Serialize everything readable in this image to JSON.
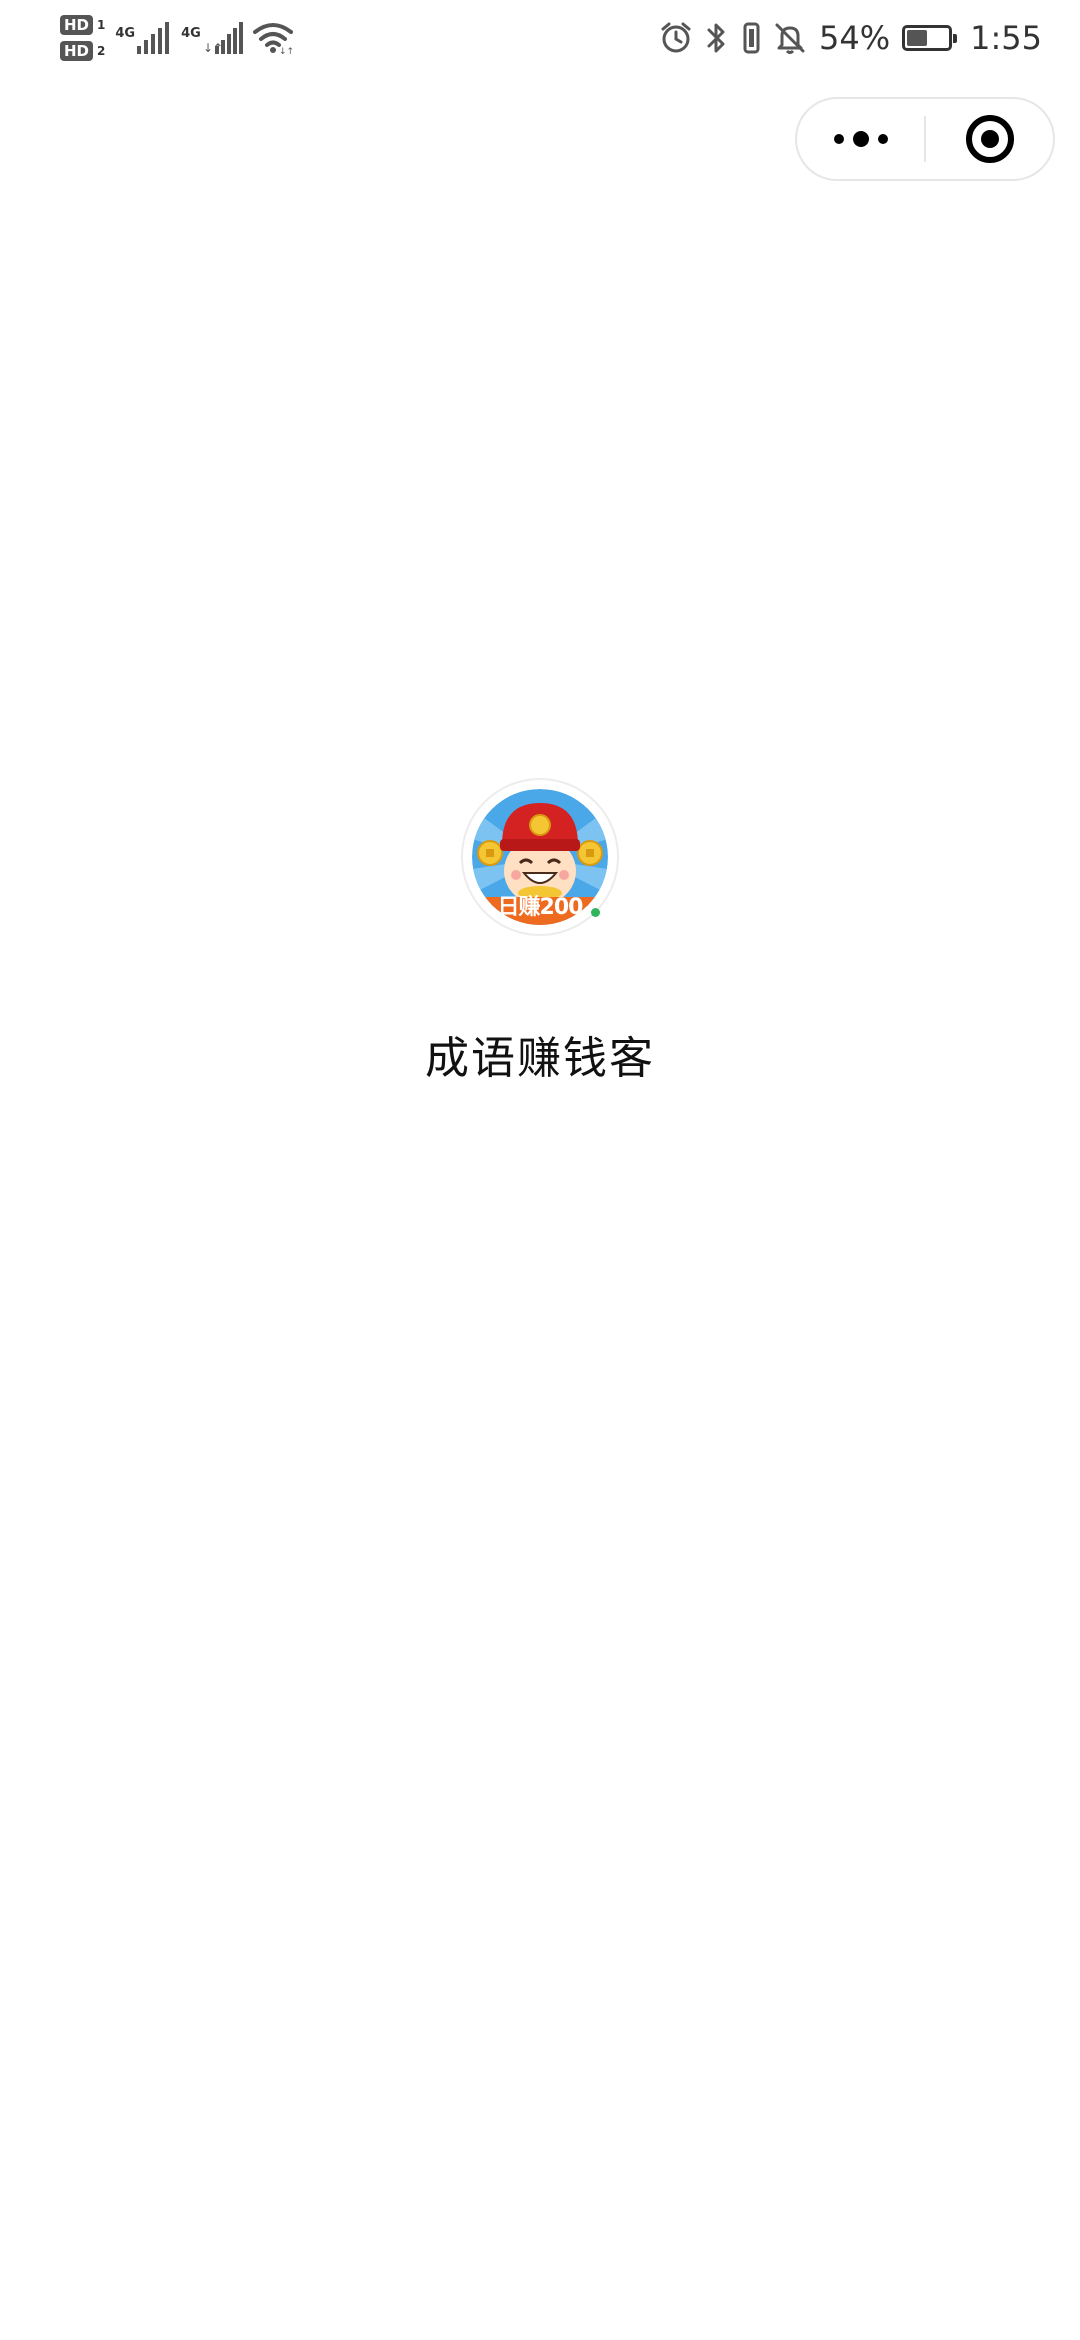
{
  "status_bar": {
    "sim1_badge": "HD",
    "sim1_index": "1",
    "sim2_badge": "HD",
    "sim2_index": "2",
    "network1": "4G",
    "network2": "4G",
    "battery_percent": "54%",
    "battery_level": 0.54,
    "time": "1:55",
    "icons": [
      "alarm-icon",
      "bluetooth-icon",
      "vibrate-icon",
      "mute-bell-icon",
      "wifi-icon",
      "signal-icon"
    ]
  },
  "capsule": {
    "more_icon": "more-dots-icon",
    "close_icon": "target-close-icon"
  },
  "loading": {
    "logo_text": "日赚200",
    "app_name": "成语赚钱客",
    "status_dot_color": "#2fb55b"
  }
}
